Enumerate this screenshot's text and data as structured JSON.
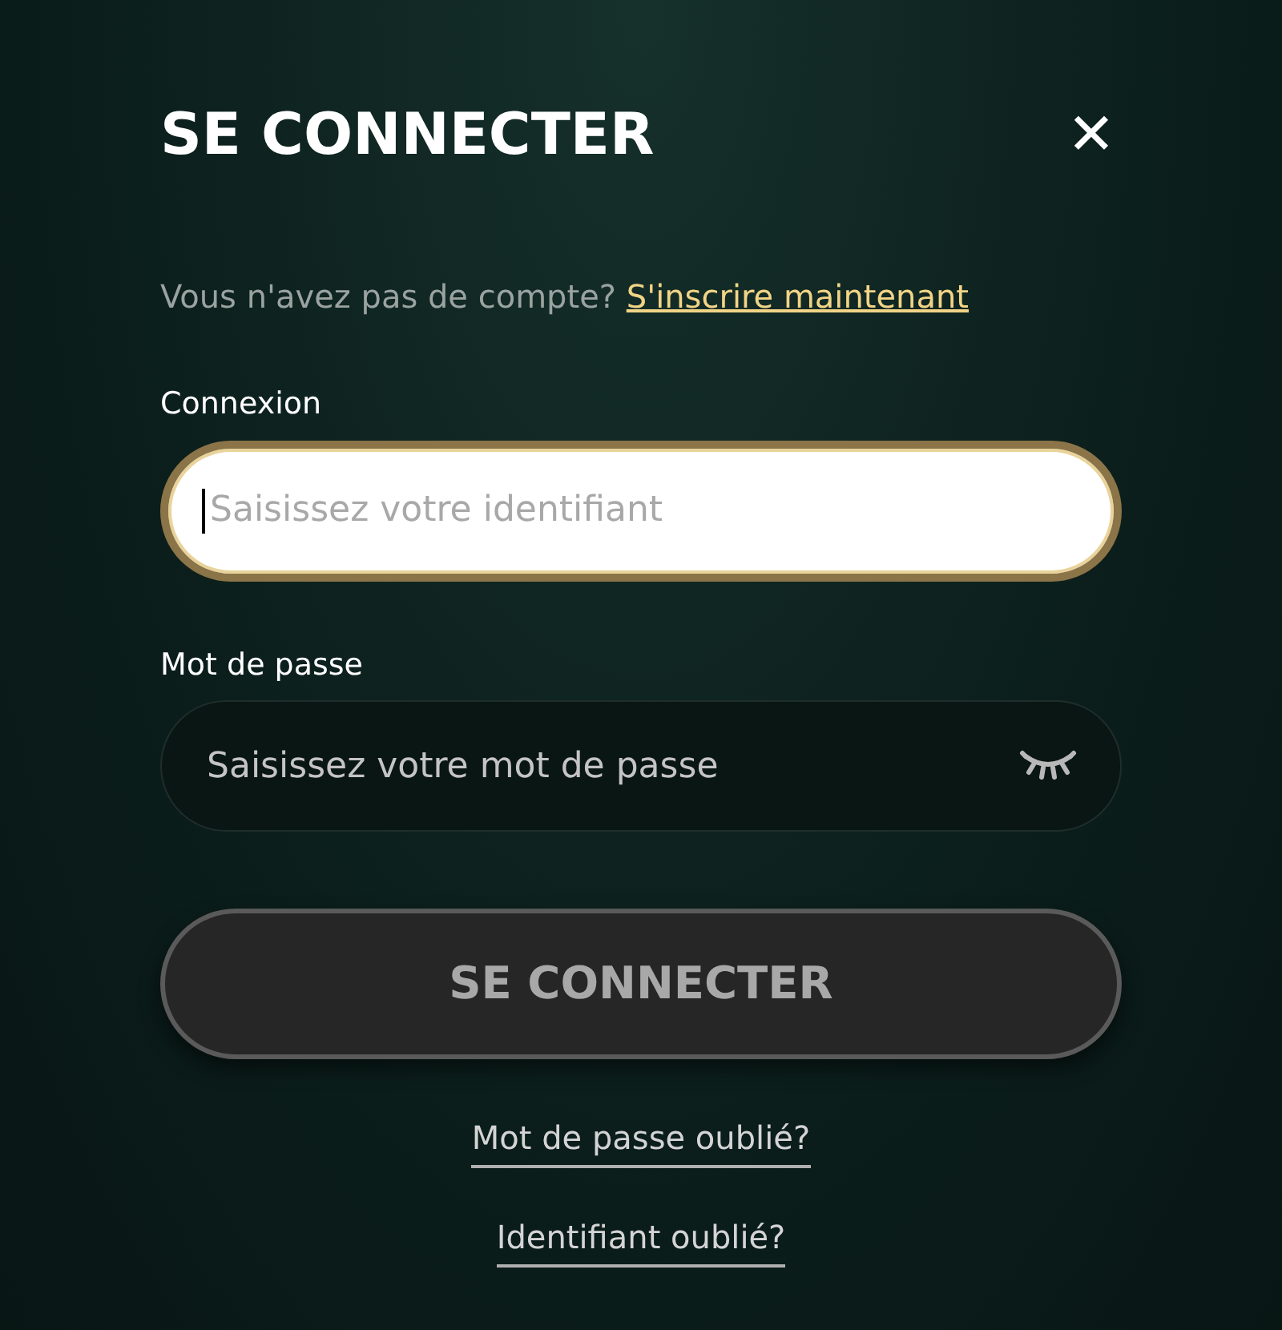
{
  "dialog": {
    "title": "SE CONNECTER",
    "close": "✕"
  },
  "signup": {
    "prompt": "Vous n'avez pas de compte?",
    "link": "S'inscrire maintenant"
  },
  "fields": [
    {
      "kind": "text",
      "label": "Connexion",
      "placeholder": "Saisissez votre identifiant",
      "focused": true
    },
    {
      "kind": "password",
      "label": "Mot de passe",
      "placeholder": "Saisissez votre mot de passe",
      "focused": false
    }
  ],
  "submit": {
    "label": "SE CONNECTER",
    "disabled": true
  },
  "links": [
    "Mot de passe oublié?",
    "Identifiant oublié?"
  ]
}
